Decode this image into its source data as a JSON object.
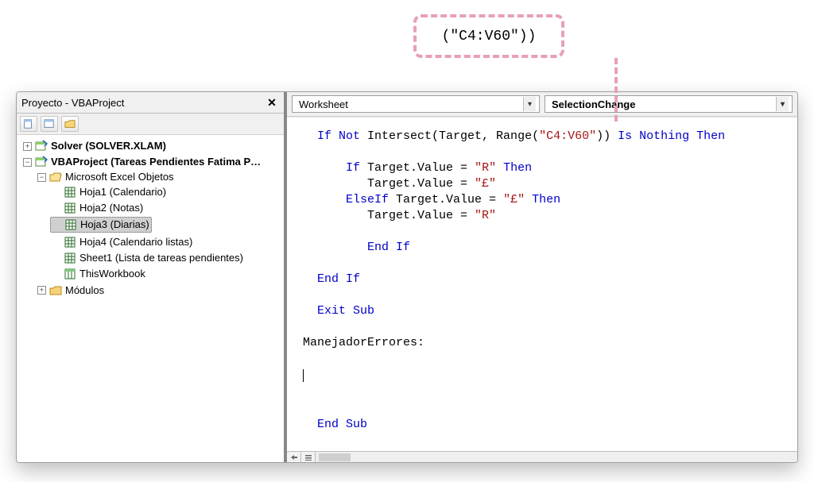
{
  "callout_text": "(\"C4:V60\"))",
  "project_panel": {
    "title": "Proyecto - VBAProject",
    "toolbar_buttons": [
      "view-code",
      "view-object",
      "toggle-folders"
    ],
    "tree": {
      "root": [
        {
          "label": "Solver (SOLVER.XLAM)",
          "bold": true,
          "icon": "vba-project",
          "expander": "plus"
        },
        {
          "label": "VBAProject (Tareas Pendientes Fatima P…",
          "bold": true,
          "icon": "vba-project",
          "expander": "minus",
          "children": [
            {
              "label": "Microsoft Excel Objetos",
              "icon": "folder-open",
              "expander": "minus",
              "children": [
                {
                  "label": "Hoja1 (Calendario)",
                  "icon": "sheet"
                },
                {
                  "label": "Hoja2 (Notas)",
                  "icon": "sheet"
                },
                {
                  "label": "Hoja3 (Diarias)",
                  "icon": "sheet",
                  "selected": true
                },
                {
                  "label": "Hoja4 (Calendario listas)",
                  "icon": "sheet"
                },
                {
                  "label": "Sheet1 (Lista de tareas pendientes)",
                  "icon": "sheet"
                },
                {
                  "label": "ThisWorkbook",
                  "icon": "workbook"
                }
              ]
            },
            {
              "label": "Módulos",
              "icon": "folder",
              "expander": "plus"
            }
          ]
        }
      ]
    }
  },
  "code_header": {
    "object_combo": "Worksheet",
    "procedure_combo": "SelectionChange"
  },
  "code": {
    "l0_indent": "  ",
    "l0_a": "If Not",
    "l0_b": " Intersect(Target, Range(",
    "l0_str": "\"C4:V60\"",
    "l0_c": ")) ",
    "l0_d": "Is Nothing Then",
    "l1_indent": "      ",
    "l1_a": "If",
    "l1_b": " Target.Value = ",
    "l1_str": "\"R\"",
    "l1_c": " ",
    "l1_d": "Then",
    "l2_indent": "         ",
    "l2_a": "Target.Value = ",
    "l2_str": "\"£\"",
    "l3_indent": "      ",
    "l3_a": "ElseIf",
    "l3_b": " Target.Value = ",
    "l3_str": "\"£\"",
    "l3_c": " ",
    "l3_d": "Then",
    "l4_indent": "         ",
    "l4_a": "Target.Value = ",
    "l4_str": "\"R\"",
    "l5_indent": "         ",
    "l5_a": "End If",
    "l6_indent": "  ",
    "l6_a": "End If",
    "l7_indent": "  ",
    "l7_a": "Exit Sub",
    "l8_a": "ManejadorErrores:",
    "l9_indent": "  ",
    "l9_a": "End Sub"
  }
}
